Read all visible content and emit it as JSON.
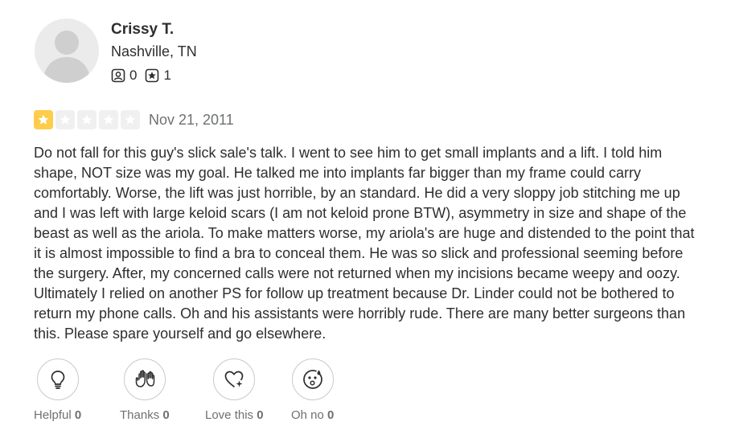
{
  "user": {
    "name": "Crissy T.",
    "location": "Nashville, TN",
    "review_count": "0",
    "photo_count": "1",
    "review_icon": "review-count-icon",
    "photo_icon": "star-badge-icon"
  },
  "rating": {
    "value": 1,
    "max": 5,
    "color_on": "#ffcc4b",
    "color_off": "#f0f0f0"
  },
  "review": {
    "date": "Nov 21, 2011",
    "text": "Do not fall for this guy's slick sale's talk. I went to see him to get small implants and a lift. I told him shape, NOT size was my goal. He talked me into implants far bigger than my frame could carry comfortably. Worse, the lift was just horrible, by an standard. He did a very sloppy job stitching me up and I was left with large keloid scars (I am not keloid prone BTW), asymmetry in size and shape of the beast as well as the ariola. To make matters worse, my ariola's are huge and distended to the point that it is almost impossible to find a bra to conceal them. He was so slick and professional seeming before the surgery. After, my concerned calls were not returned when my incisions became weepy and oozy. Ultimately I relied on another PS for follow up treatment because Dr. Linder could not be bothered to return my phone calls. Oh and his assistants were horribly rude. There are many better surgeons than this. Please spare yourself and go elsewhere."
  },
  "reactions": [
    {
      "label": "Helpful",
      "count": "0",
      "icon": "lightbulb-icon"
    },
    {
      "label": "Thanks",
      "count": "0",
      "icon": "clapping-hands-icon"
    },
    {
      "label": "Love this",
      "count": "0",
      "icon": "heart-sparkle-icon"
    },
    {
      "label": "Oh no",
      "count": "0",
      "icon": "surprised-face-icon"
    }
  ]
}
